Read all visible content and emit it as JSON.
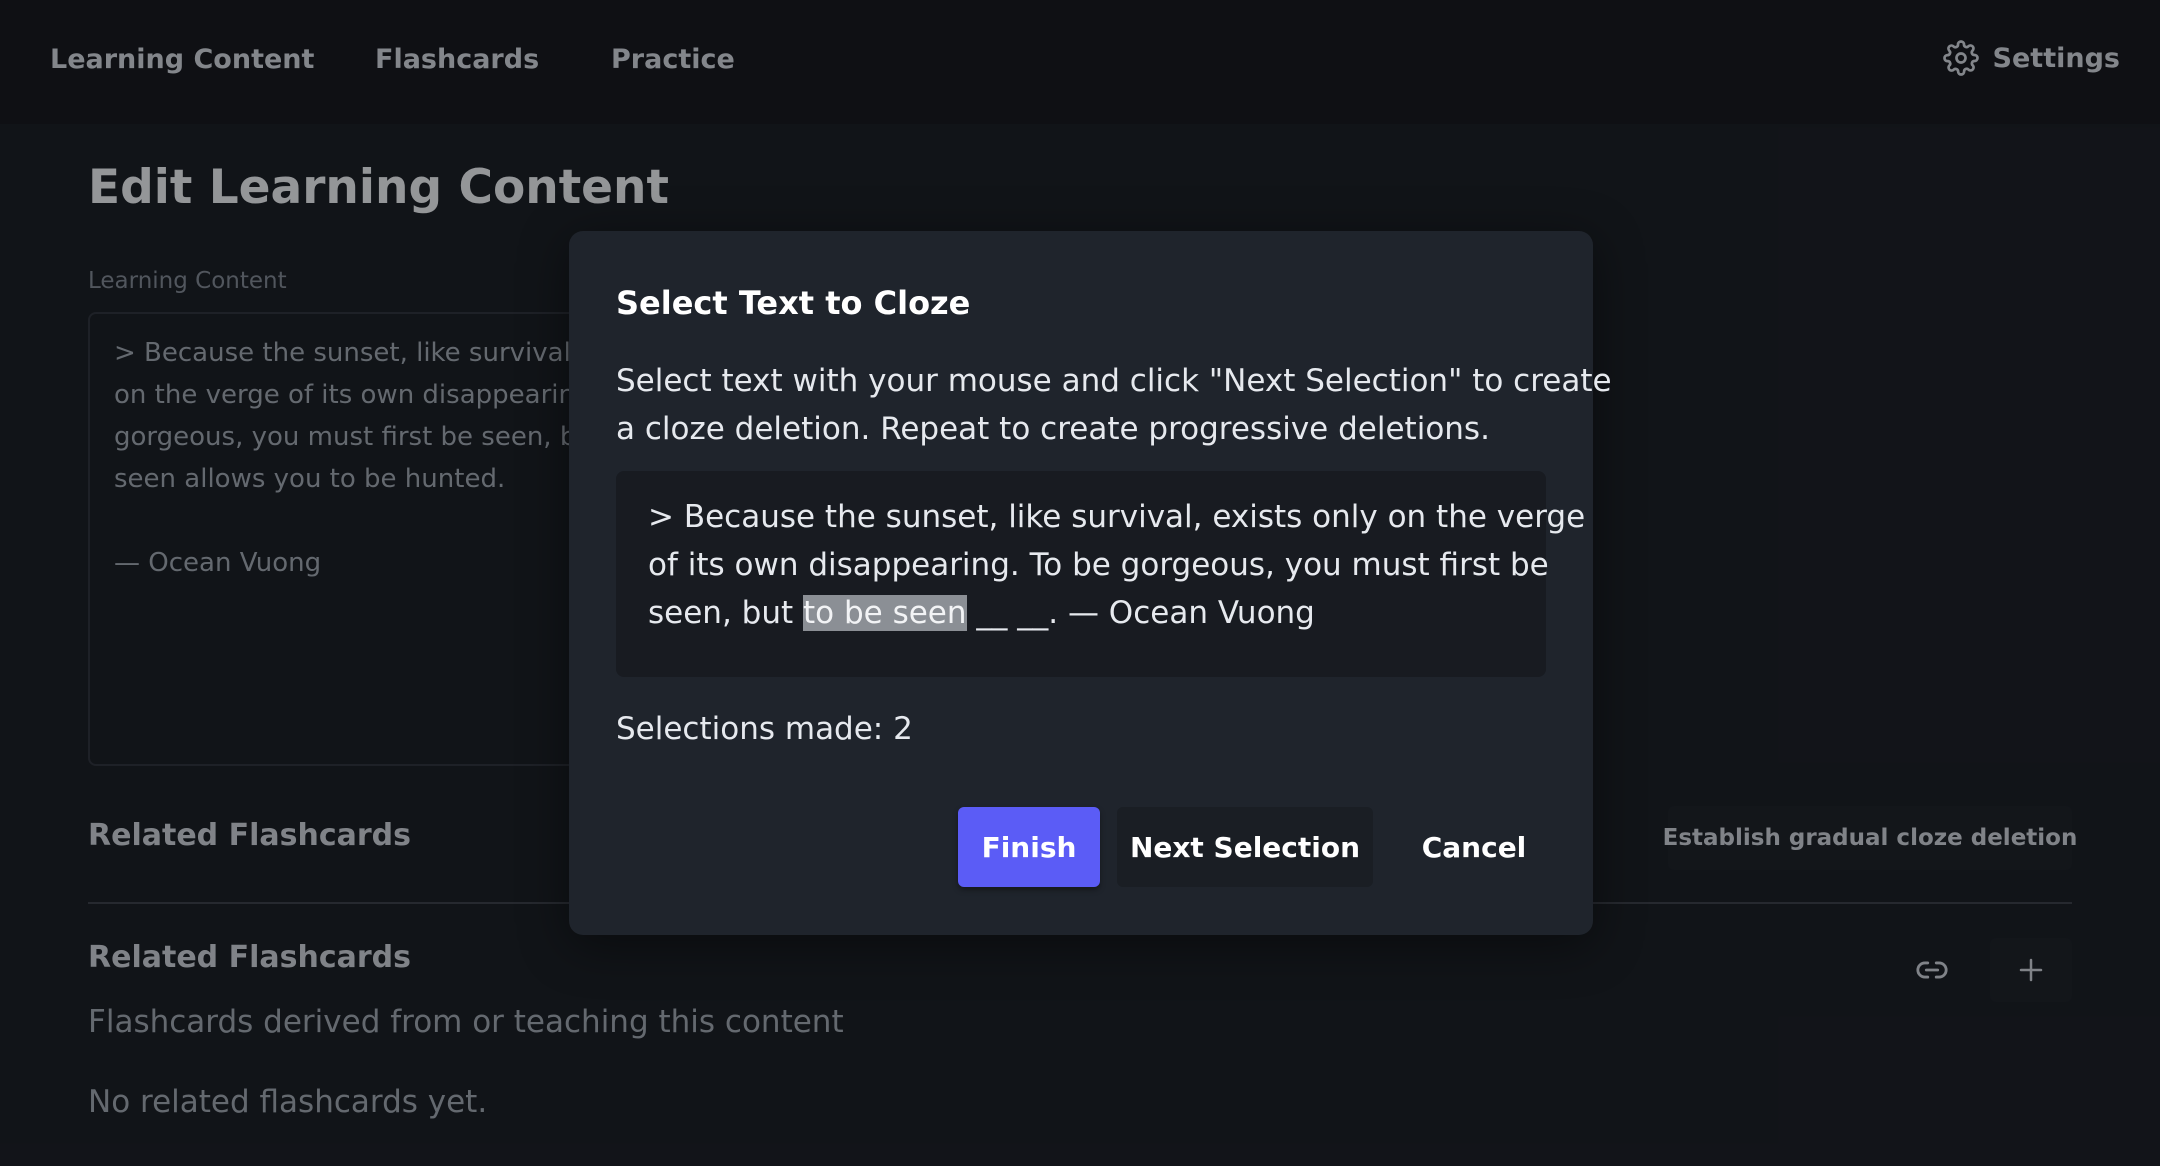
{
  "nav": {
    "items": [
      {
        "label": "Learning Content"
      },
      {
        "label": "Flashcards"
      },
      {
        "label": "Practice"
      }
    ],
    "settings_label": "Settings",
    "settings_icon": "gear-icon"
  },
  "page": {
    "title": "Edit Learning Content",
    "field_label": "Learning Content",
    "content_lines": [
      "> Because the sunset, like survival, ex",
      "on the verge of its own disappearing",
      "gorgeous, you must first be seen, bu",
      "seen allows you to be hunted.",
      "",
      "— Ocean Vuong"
    ]
  },
  "related": {
    "heading_1": "Related Flashcards",
    "gradual_button": "Establish gradual cloze deletion",
    "heading_2": "Related Flashcards",
    "subtitle": "Flashcards derived from or teaching this content",
    "empty_text": "No related flashcards yet.",
    "link_icon": "link-icon",
    "add_icon": "plus-icon"
  },
  "modal": {
    "title": "Select Text to Cloze",
    "description_lines": [
      "Select text with your mouse and click \"Next Selection\" to create",
      "a cloze deletion. Repeat to create progressive deletions."
    ],
    "preview": {
      "line1": "> Because the sunset, like survival, exists only on the verge",
      "line2": "of its own disappearing. To be gorgeous, you must first be",
      "line3_before": "seen, but ",
      "line3_highlight": "to be seen",
      "line3_after": " __ __. — Ocean Vuong"
    },
    "selections_text": "Selections made: 2",
    "finish_label": "Finish",
    "next_label": "Next Selection",
    "cancel_label": "Cancel",
    "accent_color": "#5b5cf6"
  }
}
